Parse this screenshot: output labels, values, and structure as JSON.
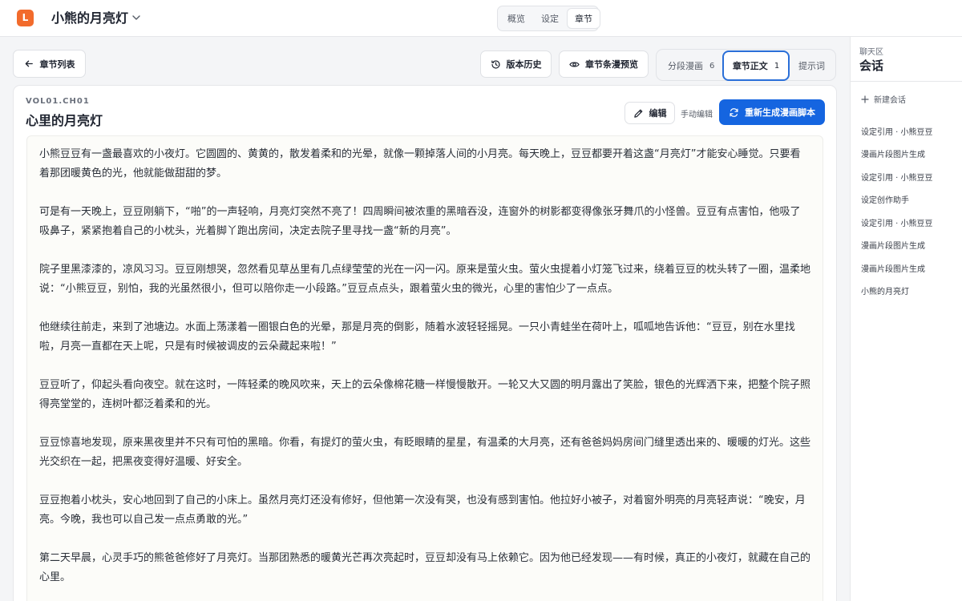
{
  "app": {
    "logo_letter": "L",
    "project_title": "小熊的月亮灯"
  },
  "topnav": {
    "items": [
      {
        "label": "概览"
      },
      {
        "label": "设定"
      },
      {
        "label": "章节"
      }
    ],
    "active": "章节"
  },
  "toolbar": {
    "back_label": "章节列表",
    "history_label": "版本历史",
    "preview_label": "章节条漫预览",
    "tabs": [
      {
        "label": "分段漫画",
        "count": "6"
      },
      {
        "label": "章节正文",
        "count": "1"
      },
      {
        "label": "提示词",
        "count": ""
      }
    ],
    "active_tab": "章节正文"
  },
  "chapter": {
    "code": "VOL01.CH01",
    "title": "心里的月亮灯",
    "edit_label": "编辑",
    "manual_edit_label": "手动编辑",
    "regenerate_label": "重新生成漫画脚本",
    "paragraphs": [
      "小熊豆豆有一盏最喜欢的小夜灯。它圆圆的、黄黄的，散发着柔和的光晕，就像一颗掉落人间的小月亮。每天晚上，豆豆都要开着这盏“月亮灯”才能安心睡觉。只要看着那团暖黄色的光，他就能做甜甜的梦。",
      "可是有一天晚上，豆豆刚躺下，“啪”的一声轻响，月亮灯突然不亮了！四周瞬间被浓重的黑暗吞没，连窗外的树影都变得像张牙舞爪的小怪兽。豆豆有点害怕，他吸了吸鼻子，紧紧抱着自己的小枕头，光着脚丫跑出房间，决定去院子里寻找一盏“新的月亮”。",
      "院子里黑漆漆的，凉风习习。豆豆刚想哭，忽然看见草丛里有几点绿莹莹的光在一闪一闪。原来是萤火虫。萤火虫提着小灯笼飞过来，绕着豆豆的枕头转了一圈，温柔地说：“小熊豆豆，别怕，我的光虽然很小，但可以陪你走一小段路。”豆豆点点头，跟着萤火虫的微光，心里的害怕少了一点点。",
      "他继续往前走，来到了池塘边。水面上荡漾着一圈银白色的光晕，那是月亮的倒影，随着水波轻轻摇晃。一只小青蛙坐在荷叶上，呱呱地告诉他：“豆豆，别在水里找啦，月亮一直都在天上呢，只是有时候被调皮的云朵藏起来啦！”",
      "豆豆听了，仰起头看向夜空。就在这时，一阵轻柔的晚风吹来，天上的云朵像棉花糖一样慢慢散开。一轮又大又圆的明月露出了笑脸，银色的光辉洒下来，把整个院子照得亮堂堂的，连树叶都泛着柔和的光。",
      "豆豆惊喜地发现，原来黑夜里并不只有可怕的黑暗。你看，有提灯的萤火虫，有眨眼睛的星星，有温柔的大月亮，还有爸爸妈妈房间门缝里透出来的、暖暖的灯光。这些光交织在一起，把黑夜变得好温暖、好安全。",
      "豆豆抱着小枕头，安心地回到了自己的小床上。虽然月亮灯还没有修好，但他第一次没有哭，也没有感到害怕。他拉好小被子，对着窗外明亮的月亮轻声说：“晚安，月亮。今晚，我也可以自己发一点点勇敢的光。”",
      "第二天早晨，心灵手巧的熊爸爸修好了月亮灯。当那团熟悉的暖黄光芒再次亮起时，豆豆却没有马上依赖它。因为他已经发现——有时候，真正的小夜灯，就藏在自己的心里。"
    ]
  },
  "chat": {
    "section_label": "聊天区",
    "title": "会话",
    "new_chat_label": "新建会话",
    "conversations": [
      "设定引用 · 小熊豆豆",
      "漫画片段图片生成",
      "设定引用 · 小熊豆豆",
      "设定创作助手",
      "设定引用 · 小熊豆豆",
      "漫画片段图片生成",
      "漫画片段图片生成",
      "小熊的月亮灯"
    ]
  },
  "colors": {
    "brand": "#f26b2c",
    "primary": "#1565e0",
    "active_tab_border": "#2a6fd8"
  }
}
